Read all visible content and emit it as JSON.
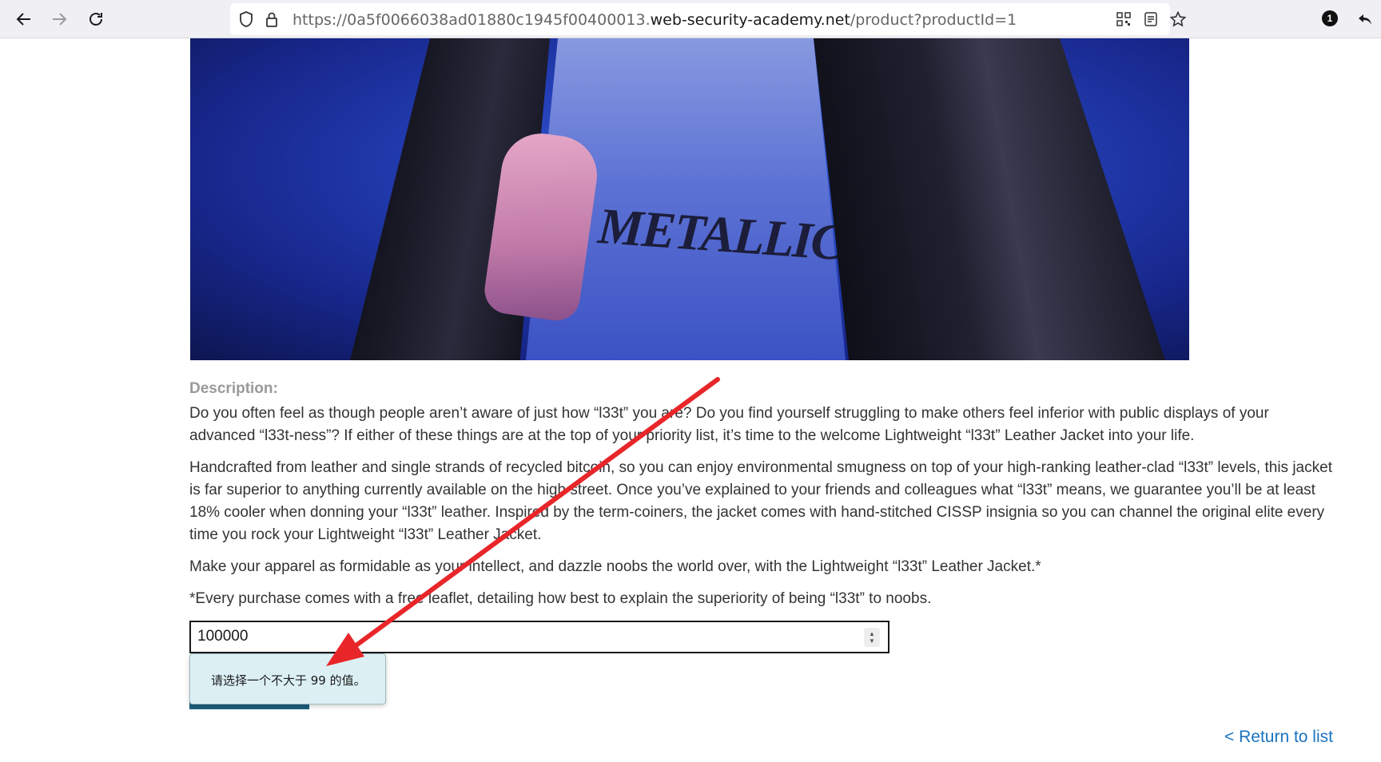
{
  "browser": {
    "url_prefix": "https://0a5f0066038ad01880c1945f00400013.",
    "url_domain": "web-security-academy.net",
    "url_path": "/product?productId=1",
    "extension_badge": "1"
  },
  "hero": {
    "shirt_print": "METALLICA"
  },
  "description": {
    "label": "Description:",
    "paragraphs": [
      "Do you often feel as though people aren’t aware of just how “l33t” you are? Do you find yourself struggling to make others feel inferior with public displays of your advanced “l33t-ness”? If either of these things are at the top of your priority list, it’s time to the welcome Lightweight “l33t” Leather Jacket into your life.",
      "Handcrafted from leather and single strands of recycled bitcoin, so you can enjoy environmental smugness on top of your high-ranking leather-clad “l33t” levels, this jacket is far superior to anything currently available on the high street. Once you’ve explained to your friends and colleagues what “l33t” means, we guarantee you’ll be at least 18% cooler when donning your “l33t” leather. Inspired by the term-coiners, the jacket comes with hand-stitched CISSP insignia so you can channel the original elite every time you rock your Lightweight “l33t” Leather Jacket.",
      "Make your apparel as formidable as your intellect, and dazzle noobs the world over, with the Lightweight “l33t” Leather Jacket.*",
      "*Every purchase comes with a free leaflet, detailing how best to explain the superiority of being “l33t” to noobs."
    ]
  },
  "quantity": {
    "value": "100000"
  },
  "validation_tooltip": {
    "message": "请选择一个不大于 99 的值。"
  },
  "return_link": "< Return to list",
  "colors": {
    "annotation_arrow": "#e8262a",
    "link": "#1a73c0",
    "tooltip_bg": "#dcf0f4"
  }
}
